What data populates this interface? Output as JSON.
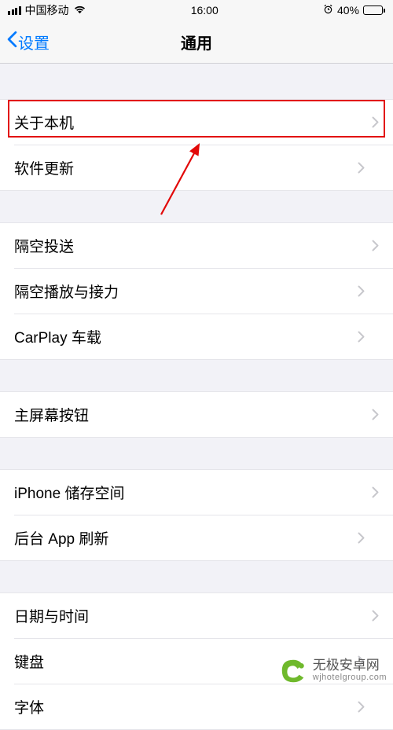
{
  "status": {
    "carrier": "中国移动",
    "time": "16:00",
    "battery_pct": "40%"
  },
  "nav": {
    "back_label": "设置",
    "title": "通用"
  },
  "groups": [
    {
      "items": [
        {
          "key": "about",
          "label": "关于本机"
        },
        {
          "key": "software_update",
          "label": "软件更新"
        }
      ]
    },
    {
      "items": [
        {
          "key": "airdrop",
          "label": "隔空投送"
        },
        {
          "key": "airplay_handoff",
          "label": "隔空播放与接力"
        },
        {
          "key": "carplay",
          "label": "CarPlay 车载"
        }
      ]
    },
    {
      "items": [
        {
          "key": "home_button",
          "label": "主屏幕按钮"
        }
      ]
    },
    {
      "items": [
        {
          "key": "iphone_storage",
          "label": "iPhone 储存空间"
        },
        {
          "key": "background_refresh",
          "label": "后台 App 刷新"
        }
      ]
    },
    {
      "items": [
        {
          "key": "date_time",
          "label": "日期与时间"
        },
        {
          "key": "keyboard",
          "label": "键盘"
        },
        {
          "key": "fonts",
          "label": "字体"
        }
      ]
    }
  ],
  "watermark": {
    "title": "无极安卓网",
    "sub": "wjhotelgroup.com"
  }
}
